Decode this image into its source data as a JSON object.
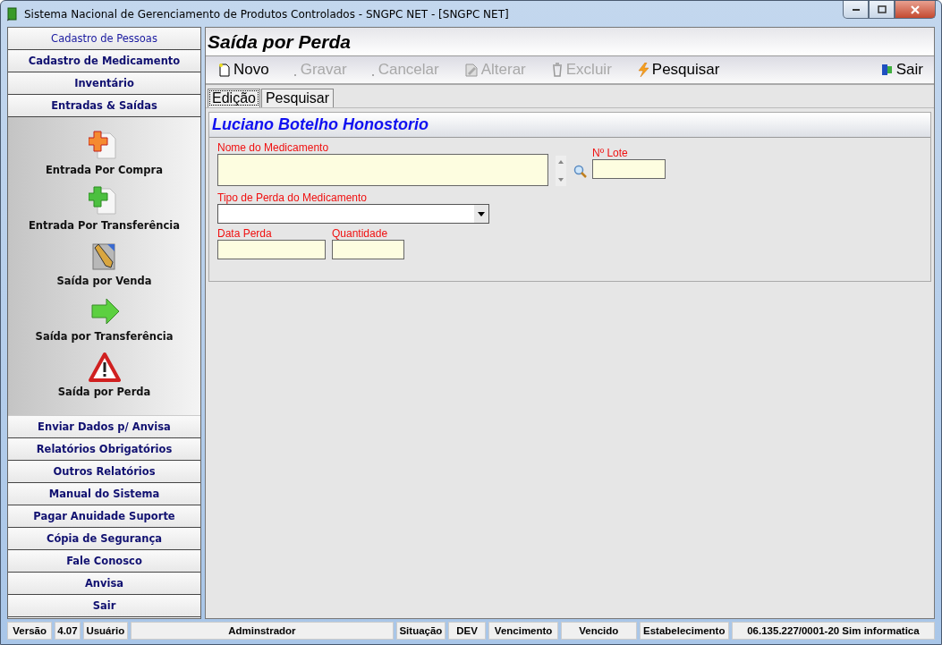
{
  "window": {
    "title": "Sistema Nacional de Gerenciamento de Produtos Controlados - SNGPC NET - [SNGPC NET]"
  },
  "sidebar": {
    "items": [
      {
        "label": "Cadastro de Pessoas",
        "selected": true,
        "expanded": false
      },
      {
        "label": "Cadastro de Medicamento",
        "selected": false,
        "expanded": false
      },
      {
        "label": "Inventário",
        "selected": false,
        "expanded": false
      },
      {
        "label": "Entradas & Saídas",
        "selected": false,
        "expanded": true,
        "children": [
          {
            "label": "Entrada Por Compra",
            "kind": "add-red"
          },
          {
            "label": "Entrada Por Transferência",
            "kind": "add-green"
          },
          {
            "label": "Saída por Venda",
            "kind": "edit"
          },
          {
            "label": "Saída por Transferência",
            "kind": "arrow"
          },
          {
            "label": "Saída por Perda",
            "kind": "warning"
          }
        ]
      },
      {
        "label": "Enviar Dados p/ Anvisa",
        "selected": false,
        "expanded": false
      },
      {
        "label": "Relatórios Obrigatórios",
        "selected": false,
        "expanded": false
      },
      {
        "label": "Outros Relatórios",
        "selected": false,
        "expanded": false
      },
      {
        "label": "Manual do Sistema",
        "selected": false,
        "expanded": false
      },
      {
        "label": "Pagar Anuidade Suporte",
        "selected": false,
        "expanded": false
      },
      {
        "label": "Cópia de Segurança",
        "selected": false,
        "expanded": false
      },
      {
        "label": "Fale Conosco",
        "selected": false,
        "expanded": false
      },
      {
        "label": "Anvisa",
        "selected": false,
        "expanded": false
      },
      {
        "label": "Sair",
        "selected": false,
        "expanded": false
      }
    ]
  },
  "page": {
    "title": "Saída por Perda"
  },
  "toolbar": [
    {
      "label": "Novo",
      "kind": "new",
      "disabled": false
    },
    {
      "label": "Gravar",
      "kind": "save",
      "disabled": true
    },
    {
      "label": "Cancelar",
      "kind": "cancel",
      "disabled": true
    },
    {
      "label": "Alterar",
      "kind": "edit",
      "disabled": true
    },
    {
      "label": "Excluir",
      "kind": "delete",
      "disabled": true
    },
    {
      "label": "Pesquisar",
      "kind": "search",
      "disabled": false
    }
  ],
  "exit_button": {
    "label": "Sair"
  },
  "tabs": [
    {
      "label": "Edição",
      "selected": true
    },
    {
      "label": "Pesquisar",
      "selected": false
    }
  ],
  "form": {
    "heading": "Luciano Botelho Honostorio",
    "medicine": {
      "label": "Nome do Medicamento"
    },
    "lot": {
      "label": "Nº Lote"
    },
    "loss_type": {
      "label": "Tipo de Perda do Medicamento"
    },
    "loss_date": {
      "label": "Data Perda"
    },
    "quantity": {
      "label": "Quantidade"
    }
  },
  "status_bar": [
    "Versão",
    "4.07",
    "Usuário",
    "Adminstrador",
    "Situação",
    "DEV",
    "Vencimento",
    "Vencido",
    "Estabelecimento",
    "06.135.227/0001-20 Sim informatica"
  ]
}
